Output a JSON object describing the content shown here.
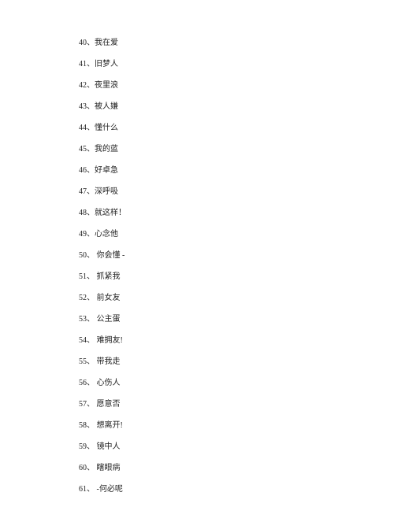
{
  "items": [
    {
      "number": "40",
      "separator": "、",
      "text": "我在爱"
    },
    {
      "number": "41",
      "separator": "、",
      "text": "旧梦人"
    },
    {
      "number": "42",
      "separator": "、",
      "text": "夜里浪"
    },
    {
      "number": "43",
      "separator": "、",
      "text": "被人嫌"
    },
    {
      "number": "44",
      "separator": "、",
      "text": "懂什么"
    },
    {
      "number": "45",
      "separator": "、",
      "text": "我的蓝"
    },
    {
      "number": "46",
      "separator": "、",
      "text": "好卓急"
    },
    {
      "number": "47",
      "separator": "、",
      "text": "深呼吸"
    },
    {
      "number": "48",
      "separator": "、",
      "text": "就这样！"
    },
    {
      "number": "49",
      "separator": "、",
      "text": "心念他"
    },
    {
      "number": "50",
      "separator": "、",
      "text": " 你会懂 -"
    },
    {
      "number": "51",
      "separator": "、",
      "text": " 抓紧我"
    },
    {
      "number": "52",
      "separator": "、",
      "text": " 前女友"
    },
    {
      "number": "53",
      "separator": "、",
      "text": " 公主蛋"
    },
    {
      "number": "54",
      "separator": "、",
      "text": " 难拥友!"
    },
    {
      "number": "55",
      "separator": "、",
      "text": " 带我走"
    },
    {
      "number": "56",
      "separator": "、",
      "text": " 心伤人"
    },
    {
      "number": "57",
      "separator": "、",
      "text": " 愿意否"
    },
    {
      "number": "58",
      "separator": "、",
      "text": " 想离开!"
    },
    {
      "number": "59",
      "separator": "、",
      "text": " 镜中人"
    },
    {
      "number": "60",
      "separator": "、",
      "text": " 瞎眼病"
    },
    {
      "number": "61",
      "separator": "、",
      "text": " -何必呢"
    }
  ]
}
